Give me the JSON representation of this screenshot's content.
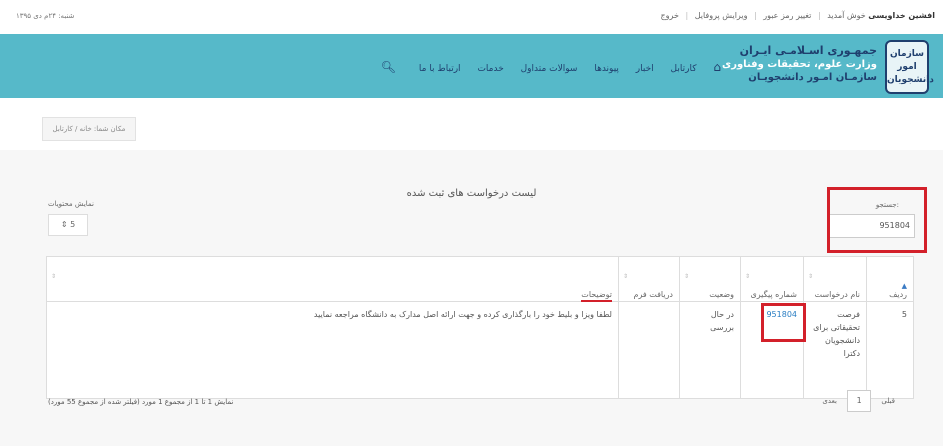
{
  "topbar": {
    "date": "شنبه: ۲۴م دی ۱۳۹۵",
    "welcome_name": "افشین خداویسی",
    "welcome_suffix": "خوش آمدید",
    "links": [
      "تغییر رمز عبور",
      "ویرایش پروفایل",
      "خروج"
    ]
  },
  "header": {
    "logo_text": "سازمان امور دانشجویان",
    "org_line1": "جمهـوری اسـلامـی ایـران",
    "org_line2": "وزارت علوم، تحقیقات وفناوری",
    "org_line3": "سازمـان امـور دانشجویـان",
    "nav": [
      "کارتابل",
      "اخبار",
      "پیوندها",
      "سوالات متداول",
      "خدمات",
      "ارتباط با ما"
    ],
    "home_icon": "home-icon",
    "search_icon": "search-icon"
  },
  "breadcrumb": "مکان شما: خانه / کارتابل",
  "list_title": "لیست درخواست های ثبت شده",
  "filter": {
    "show_label": "نمایش محتویات",
    "show_value": "5"
  },
  "search": {
    "label": "جستجو:",
    "value": "951804"
  },
  "table": {
    "headers": [
      "ردیف",
      "نام درخواست",
      "شماره پیگیری",
      "وضعیت",
      "دریافت فرم",
      "توضیحات"
    ],
    "rows": [
      {
        "row_no": "5",
        "name": "فرصت تحقیقاتی برای دانشجویان دکترا",
        "tracking": "951804",
        "status": "در حال بررسی",
        "form": "",
        "description": "لطفا ویزا و بلیط خود را بارگذاری کرده و جهت ارائه اصل مدارک به دانشگاه مراجعه نمایید"
      }
    ]
  },
  "summary": "نمایش 1 تا 1 از مجموع 1 مورد (فیلتر شده از مجموع 55 مورد)",
  "pager": {
    "prev": "قبلی",
    "page": "1",
    "next": "بعدی"
  },
  "colors": {
    "header_bg": "#56b9c9",
    "highlight": "#d3202a",
    "link": "#2a7ec3"
  }
}
